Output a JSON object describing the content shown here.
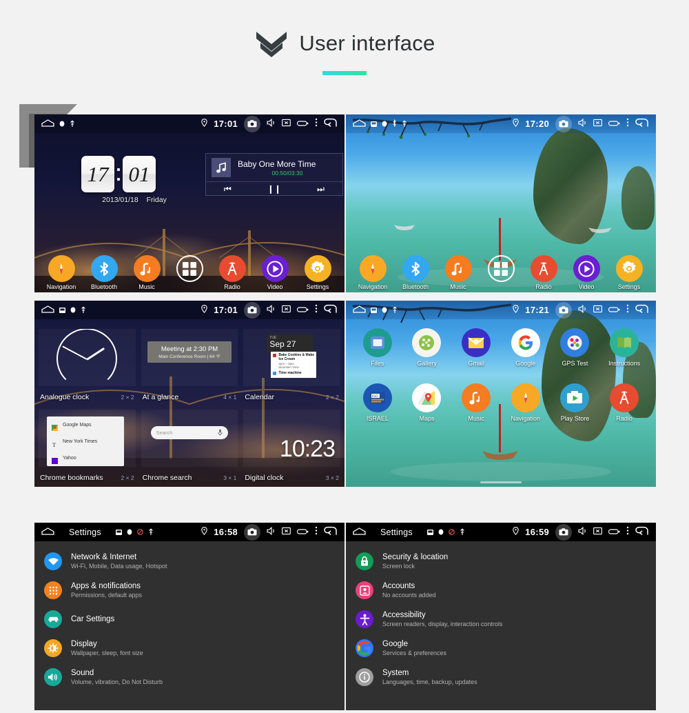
{
  "header": {
    "title": "User interface",
    "chevron_icon": "double-chevron-down-icon",
    "accent_from": "#35d6e8",
    "accent_to": "#2ce59b"
  },
  "statusbar_common": {
    "icons": [
      "home-icon",
      "sd-card-icon",
      "dot-icon",
      "usb-icon",
      "location-pin-icon",
      "camera-icon",
      "volume-icon",
      "screenshot-icon",
      "battery-icon",
      "overflow-menu-icon",
      "back-arrow-icon"
    ]
  },
  "panels": {
    "home": {
      "name": "Home screen",
      "time": "17:01",
      "clock": {
        "hours": "17",
        "minutes": "01",
        "date": "2013/01/18",
        "weekday": "Friday"
      },
      "player": {
        "track": "Baby One More Time",
        "time": "00:50/03:30",
        "time_color": "#49c06a",
        "prev_label": "⏮",
        "pause_label": "❙❙",
        "next_label": "⏭"
      },
      "dock": [
        {
          "label": "Navigation",
          "icon": "compass-icon",
          "color": "#f9a825"
        },
        {
          "label": "Bluetooth",
          "icon": "bluetooth-icon",
          "color": "#33a7ef"
        },
        {
          "label": "Music",
          "icon": "music-note-icon",
          "color": "#f57c20"
        },
        {
          "label": "Apps",
          "icon": "app-drawer-grid-icon",
          "color": "transparent"
        },
        {
          "label": "Radio",
          "icon": "radio-tower-icon",
          "color": "#e74b30"
        },
        {
          "label": "Video",
          "icon": "play-circle-icon",
          "color": "#6a1fd0"
        },
        {
          "label": "Settings",
          "icon": "gear-icon",
          "color": "#f5b225"
        }
      ]
    },
    "beach": {
      "name": "Home screen beach wallpaper",
      "time": "17:20",
      "dock": [
        {
          "label": "Navigation",
          "icon": "compass-icon",
          "color": "#f9a825"
        },
        {
          "label": "Bluetooth",
          "icon": "bluetooth-icon",
          "color": "#33a7ef"
        },
        {
          "label": "Music",
          "icon": "music-note-icon",
          "color": "#f57c20"
        },
        {
          "label": "Apps",
          "icon": "app-drawer-grid-icon",
          "color": "transparent"
        },
        {
          "label": "Radio",
          "icon": "radio-tower-icon",
          "color": "#e74b30"
        },
        {
          "label": "Video",
          "icon": "play-circle-icon",
          "color": "#6a1fd0"
        },
        {
          "label": "Settings",
          "icon": "gear-icon",
          "color": "#f5b225"
        }
      ]
    },
    "widgets": {
      "name": "Widget picker",
      "time": "17:01",
      "items": [
        {
          "label": "Analogue clock",
          "size": "2 × 2"
        },
        {
          "label": "At a glance",
          "size": "4 × 1",
          "preview_title": "Meeting at 2:30 PM",
          "preview_sub": "Main Conference Room  |  64 °F"
        },
        {
          "label": "Calendar",
          "size": "2 × 2",
          "cal_dow": "TUE",
          "cal_date": "Sep 27",
          "events": [
            {
              "title": "Bake Cookies & Make Ice Cream",
              "time": "2pm – 3pm",
              "place": "Mountain View",
              "color": "#c0392b"
            },
            {
              "title": "Time machine",
              "time": "",
              "place": "",
              "color": "#4a90d9"
            }
          ]
        },
        {
          "label": "Chrome bookmarks",
          "size": "2 × 2",
          "bookmarks": [
            "Google Maps",
            "New York Times",
            "Yahoo"
          ]
        },
        {
          "label": "Chrome search",
          "size": "3 × 1",
          "search_placeholder": "Search",
          "mic_icon": "microphone-icon"
        },
        {
          "label": "Digital clock",
          "size": "3 × 2",
          "clock": "10:23"
        }
      ]
    },
    "apps": {
      "name": "App drawer",
      "time": "17:21",
      "rows": [
        [
          {
            "label": "Files",
            "icon": "folder-icon",
            "color": "#1d9c8f"
          },
          {
            "label": "Gallery",
            "icon": "palette-icon",
            "color": "#f7f4ec"
          },
          {
            "label": "Gmail",
            "icon": "envelope-icon",
            "color": "#3a2fc4"
          },
          {
            "label": "Google",
            "icon": "google-g-icon",
            "color": "#ffffff"
          },
          {
            "label": "GPS Test",
            "icon": "satellite-icon",
            "color": "#2f7fe0"
          },
          {
            "label": "Instructions",
            "icon": "book-icon",
            "color": "#2bb39a"
          }
        ],
        [
          {
            "label": "ISRAEL",
            "icon": "igo-navigation-icon",
            "color": "#1c56b5"
          },
          {
            "label": "Maps",
            "icon": "maps-pin-icon",
            "color": "#ffffff"
          },
          {
            "label": "Music",
            "icon": "music-note-icon",
            "color": "#f57c20"
          },
          {
            "label": "Navigation",
            "icon": "compass-icon",
            "color": "#f9a825"
          },
          {
            "label": "Play Store",
            "icon": "play-store-icon",
            "color": "#2f9fd0"
          },
          {
            "label": "Radio",
            "icon": "radio-tower-icon",
            "color": "#e74b30"
          }
        ]
      ]
    },
    "settings_left": {
      "name": "Settings",
      "title": "Settings",
      "time": "16:58",
      "items": [
        {
          "title": "Network & Internet",
          "sub": "Wi-Fi, Mobile, Data usage, Hotspot",
          "icon": "wifi-icon",
          "color": "#2196f3"
        },
        {
          "title": "Apps & notifications",
          "sub": "Permissions, default apps",
          "icon": "apps-dots-icon",
          "color": "#f4821f"
        },
        {
          "title": "Car Settings",
          "sub": "",
          "icon": "car-icon",
          "color": "#18a999"
        },
        {
          "title": "Display",
          "sub": "Wallpaper, sleep, font size",
          "icon": "brightness-icon",
          "color": "#f5a623"
        },
        {
          "title": "Sound",
          "sub": "Volume, vibration, Do Not Disturb",
          "icon": "speaker-icon",
          "color": "#18a999"
        }
      ]
    },
    "settings_right": {
      "name": "Settings",
      "title": "Settings",
      "time": "16:59",
      "items": [
        {
          "title": "Security & location",
          "sub": "Screen lock",
          "icon": "lock-icon",
          "color": "#0f9d58"
        },
        {
          "title": "Accounts",
          "sub": "No accounts added",
          "icon": "account-badge-icon",
          "color": "#ec407a"
        },
        {
          "title": "Accessibility",
          "sub": "Screen readers, display, interaction controls",
          "icon": "accessibility-icon",
          "color": "#6a1bd1"
        },
        {
          "title": "Google",
          "sub": "Services & preferences",
          "icon": "google-g-icon",
          "color": "#2979ff"
        },
        {
          "title": "System",
          "sub": "Languages, time, backup, updates",
          "icon": "info-icon",
          "color": "#9e9e9e"
        }
      ]
    }
  }
}
